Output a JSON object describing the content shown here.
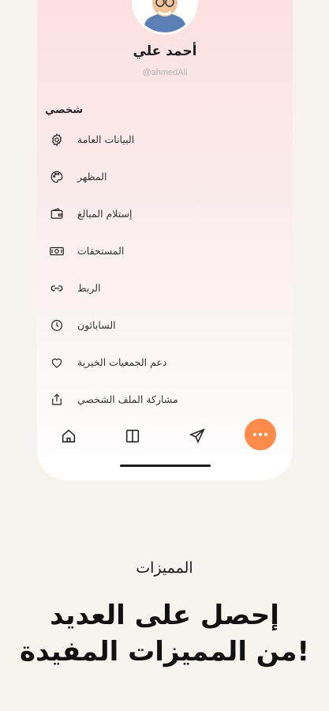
{
  "profile": {
    "name": "أحمد علي",
    "handle": "@ahmedAli"
  },
  "section_title": "شخصي",
  "menu": [
    {
      "label": "البيانات العامة",
      "icon": "gear-icon"
    },
    {
      "label": "المظهر",
      "icon": "palette-icon"
    },
    {
      "label": "إستلام المبالغ",
      "icon": "wallet-icon"
    },
    {
      "label": "المستحقات",
      "icon": "cash-icon"
    },
    {
      "label": "الربط",
      "icon": "link-icon"
    },
    {
      "label": "السابائون",
      "icon": "clock-icon"
    },
    {
      "label": "دعم الجمعيات الخيرية",
      "icon": "heart-icon"
    },
    {
      "label": "مشاركة الملف الشخصي",
      "icon": "share-icon"
    }
  ],
  "tabbar": [
    "home-icon",
    "columns-icon",
    "send-icon",
    "more-icon"
  ],
  "accent": "#ff8a4a",
  "caption": "المميزات",
  "headline": {
    "line1": "إحصل على العديد",
    "line2": "من المميزات المفيدة!"
  }
}
